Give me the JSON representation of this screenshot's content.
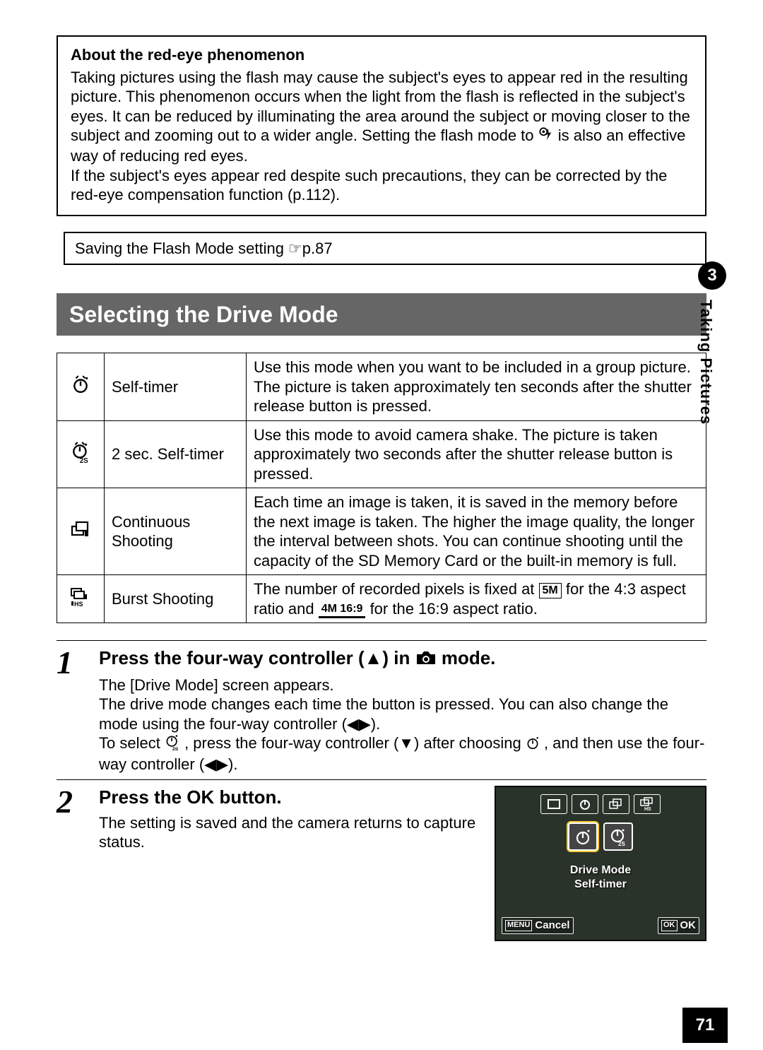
{
  "box": {
    "title": "About the red-eye phenomenon",
    "text_a": "Taking pictures using the flash may cause the subject's eyes to appear red in the resulting picture. This phenomenon occurs when the light from the flash is reflected in the subject's eyes. It can be reduced by illuminating the area around the subject or moving closer to the subject and zooming out to a wider angle. Setting the flash mode to ",
    "text_b": " is also an effective way of reducing red eyes.",
    "text_c": "If the subject's eyes appear red despite such precautions, they can be corrected by the red-eye compensation function (p.112)."
  },
  "smallbox": "Saving the Flash Mode setting ☞p.87",
  "section_title": "Selecting the Drive Mode",
  "modes": [
    {
      "name": "Self-timer",
      "desc": "Use this mode when you want to be included in a group picture. The picture is taken approximately ten seconds after the shutter release button is pressed."
    },
    {
      "name": "2 sec. Self-timer",
      "desc": "Use this mode to avoid camera shake. The picture is taken approximately two seconds after the shutter release button is pressed."
    },
    {
      "name": "Continuous Shooting",
      "desc": "Each time an image is taken, it is saved in the memory before the next image is taken. The higher the image quality, the longer the interval between shots. You can continue shooting until the capacity of the SD Memory Card or the built-in memory is full."
    },
    {
      "name": "Burst Shooting",
      "desc_a": "The number of recorded pixels is fixed at ",
      "desc_b": " for the 4:3 aspect ratio and ",
      "desc_c": " for the 16:9 aspect ratio.",
      "pix1": "5M",
      "pix2": "4M 16:9"
    }
  ],
  "steps": [
    {
      "num": "1",
      "title_a": "Press the four-way controller (▲) in ",
      "title_b": " mode.",
      "body_a": "The [Drive Mode] screen appears.",
      "body_b": "The drive mode changes each time the button is pressed. You can also change the mode using the four-way controller (◀▶).",
      "body_c_a": "To select ",
      "body_c_b": ", press the four-way controller (▼) after choosing ",
      "body_c_c": ", and then use the four-way controller (◀▶)."
    },
    {
      "num": "2",
      "title": "Press the OK button.",
      "body": "The setting is saved and the camera returns to capture status."
    }
  ],
  "lcd": {
    "line1": "Drive Mode",
    "line2": "Self-timer",
    "menu": "MENU",
    "cancel": "Cancel",
    "ok_box": "OK",
    "ok": "OK"
  },
  "tab": {
    "chapter": "3",
    "label": "Taking Pictures"
  },
  "page": "71"
}
